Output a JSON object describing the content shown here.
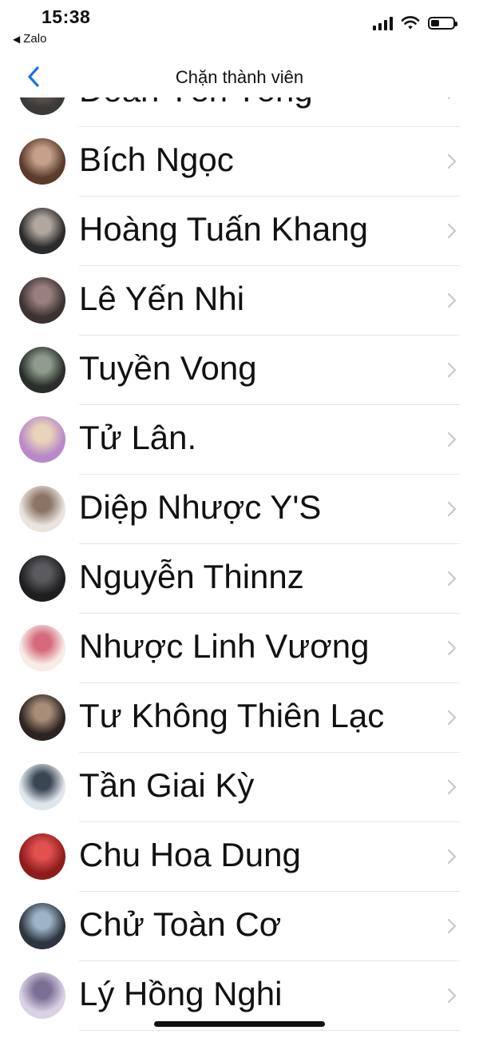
{
  "status_bar": {
    "time": "15:38",
    "back_app": "Zalo",
    "battery_level": 0.4
  },
  "nav": {
    "title": "Chặn thành viên"
  },
  "members": [
    {
      "name": "Đoàn Yến Tống",
      "avatar_colors": [
        "#3a3a3a",
        "#6b5a52"
      ]
    },
    {
      "name": "Bích Ngọc",
      "avatar_colors": [
        "#5a3b2c",
        "#c7a08a"
      ]
    },
    {
      "name": "Hoàng Tuấn Khang",
      "avatar_colors": [
        "#2b2b2b",
        "#b0a7a0"
      ]
    },
    {
      "name": "Lê Yến Nhi",
      "avatar_colors": [
        "#3c3232",
        "#9a7f7f"
      ]
    },
    {
      "name": "Tuyền Vong",
      "avatar_colors": [
        "#2a2e2a",
        "#8f9b8e"
      ]
    },
    {
      "name": "Tử Lân.",
      "avatar_colors": [
        "#b989c9",
        "#e9d4b8"
      ]
    },
    {
      "name": "Diệp Nhược Y'S",
      "avatar_colors": [
        "#e9e4de",
        "#8c7465"
      ]
    },
    {
      "name": "Nguyễn Thinnz",
      "avatar_colors": [
        "#1e1e20",
        "#5b5a5e"
      ]
    },
    {
      "name": "Nhược Linh Vương",
      "avatar_colors": [
        "#f7ece6",
        "#d46a7c"
      ]
    },
    {
      "name": "Tư Không Thiên Lạc",
      "avatar_colors": [
        "#2c2420",
        "#a88d78"
      ]
    },
    {
      "name": "Tần Giai Kỳ",
      "avatar_colors": [
        "#dfe6ec",
        "#3b4654"
      ]
    },
    {
      "name": "Chu Hoa Dung",
      "avatar_colors": [
        "#8e1c1c",
        "#e25050"
      ]
    },
    {
      "name": "Chử Toàn Cơ",
      "avatar_colors": [
        "#2c3540",
        "#9db4c8"
      ]
    },
    {
      "name": "Lý Hồng Nghi",
      "avatar_colors": [
        "#d9d2e4",
        "#7c6f96"
      ]
    }
  ],
  "colors": {
    "accent": "#1a73e8",
    "chevron": "#c7c7cc",
    "divider": "#e6e6e6"
  }
}
